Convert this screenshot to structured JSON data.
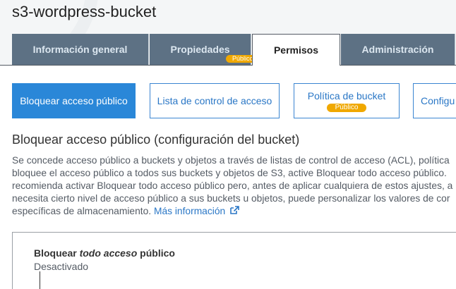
{
  "bucket": {
    "name": "s3-wordpress-bucket"
  },
  "tabs": [
    {
      "label": "Información general",
      "badge": ""
    },
    {
      "label": "Propiedades",
      "badge": "Público"
    },
    {
      "label": "Permisos",
      "badge": ""
    },
    {
      "label": "Administración",
      "badge": ""
    }
  ],
  "subtabs": [
    {
      "label": "Bloquear acceso público",
      "badge": ""
    },
    {
      "label": "Lista de control de acceso",
      "badge": ""
    },
    {
      "label": "Política de bucket",
      "badge": "Público"
    },
    {
      "label": "Configu",
      "badge": ""
    }
  ],
  "section": {
    "title": "Bloquear acceso público (configuración del bucket)",
    "description_lines": [
      "Se concede acceso público a buckets y objetos a través de listas de control de acceso (ACL), política",
      "bloquee el acceso público a todos sus buckets y objetos de S3, active Bloquear todo acceso público.",
      "recomienda activar Bloquear todo acceso público pero, antes de aplicar cualquiera de estos ajustes, a",
      "necesita cierto nivel de acceso público a sus buckets u objetos, puede personalizar los valores de cor",
      "específicas de almacenamiento."
    ],
    "more_info_link": "Más información"
  },
  "block_all": {
    "title_prefix": "Bloquear",
    "title_emphasis": "todo acceso",
    "title_suffix": "público",
    "status": "Desactivado"
  },
  "colors": {
    "tab_inactive": "#5d7184",
    "badge": "#f0a800",
    "link": "#2a77c6",
    "active_subtab": "#2a87d8"
  }
}
